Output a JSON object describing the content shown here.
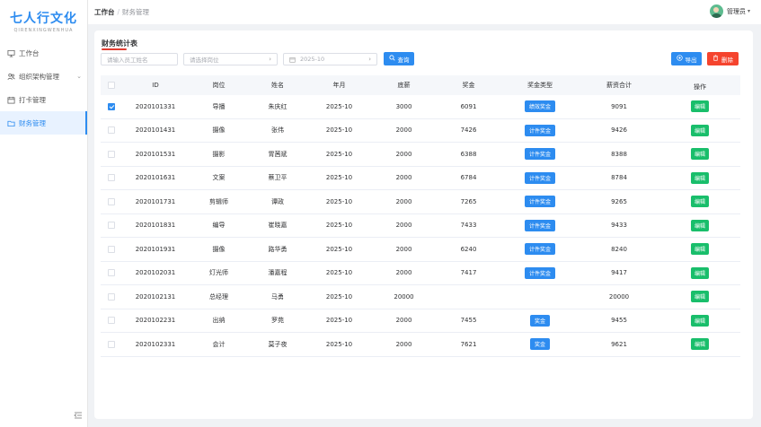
{
  "sidebar": {
    "logo_main": "七人行文化",
    "logo_sub": "QIRENXINGWENHUA",
    "items": [
      {
        "label": "工作台",
        "icon": "monitor-icon"
      },
      {
        "label": "组织架构管理",
        "icon": "org-icon"
      },
      {
        "label": "打卡管理",
        "icon": "calendar-icon"
      },
      {
        "label": "财务管理",
        "icon": "folder-icon"
      }
    ]
  },
  "header": {
    "breadcrumb_home": "工作台",
    "breadcrumb_sep": "/",
    "breadcrumb_current": "财务管理",
    "user_name": "管理员"
  },
  "main": {
    "title": "财务统计表",
    "filters": {
      "name_placeholder": "请输入员工姓名",
      "position_placeholder": "请选择岗位",
      "month_value": "2025-10",
      "search_label": "查询"
    },
    "actions": {
      "export_label": "导出",
      "delete_label": "删除"
    }
  },
  "table": {
    "headers": [
      "ID",
      "岗位",
      "姓名",
      "年月",
      "底薪",
      "奖金",
      "奖金类型",
      "薪资合计",
      "操作"
    ],
    "edit_label": "编辑",
    "rows": [
      {
        "checked": true,
        "id": "2020101331",
        "position": "导播",
        "name": "朱庆红",
        "month": "2025-10",
        "base": "3000",
        "bonus": "6091",
        "bonus_type": "绩效奖金",
        "total": "9091"
      },
      {
        "checked": false,
        "id": "2020101431",
        "position": "摄像",
        "name": "张伟",
        "month": "2025-10",
        "base": "2000",
        "bonus": "7426",
        "bonus_type": "计件奖金",
        "total": "9426"
      },
      {
        "checked": false,
        "id": "2020101531",
        "position": "摄影",
        "name": "胃茜斌",
        "month": "2025-10",
        "base": "2000",
        "bonus": "6388",
        "bonus_type": "计件奖金",
        "total": "8388"
      },
      {
        "checked": false,
        "id": "2020101631",
        "position": "文案",
        "name": "蔡卫平",
        "month": "2025-10",
        "base": "2000",
        "bonus": "6784",
        "bonus_type": "计件奖金",
        "total": "8784"
      },
      {
        "checked": false,
        "id": "2020101731",
        "position": "剪辑师",
        "name": "谭政",
        "month": "2025-10",
        "base": "2000",
        "bonus": "7265",
        "bonus_type": "计件奖金",
        "total": "9265"
      },
      {
        "checked": false,
        "id": "2020101831",
        "position": "编导",
        "name": "崔晓嘉",
        "month": "2025-10",
        "base": "2000",
        "bonus": "7433",
        "bonus_type": "计件奖金",
        "total": "9433"
      },
      {
        "checked": false,
        "id": "2020101931",
        "position": "摄像",
        "name": "路华勇",
        "month": "2025-10",
        "base": "2000",
        "bonus": "6240",
        "bonus_type": "计件奖金",
        "total": "8240"
      },
      {
        "checked": false,
        "id": "2020102031",
        "position": "灯光师",
        "name": "潘嘉程",
        "month": "2025-10",
        "base": "2000",
        "bonus": "7417",
        "bonus_type": "计件奖金",
        "total": "9417"
      },
      {
        "checked": false,
        "id": "2020102131",
        "position": "总经理",
        "name": "马勇",
        "month": "2025-10",
        "base": "20000",
        "bonus": "",
        "bonus_type": "",
        "total": "20000"
      },
      {
        "checked": false,
        "id": "2020102231",
        "position": "出纳",
        "name": "罗苑",
        "month": "2025-10",
        "base": "2000",
        "bonus": "7455",
        "bonus_type": "奖金",
        "total": "9455"
      },
      {
        "checked": false,
        "id": "2020102331",
        "position": "会计",
        "name": "莫子夜",
        "month": "2025-10",
        "base": "2000",
        "bonus": "7621",
        "bonus_type": "奖金",
        "total": "9621"
      }
    ]
  },
  "colors": {
    "primary": "#2d8cf0",
    "danger": "#f5442e",
    "success": "#19be6b",
    "accent_underline": "#e03c31"
  }
}
